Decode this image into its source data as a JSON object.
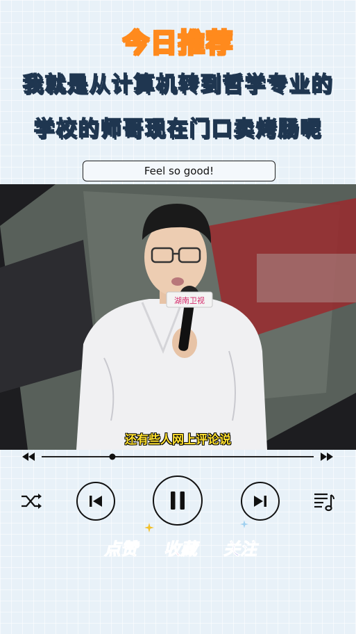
{
  "badge": {
    "label": "今日推荐"
  },
  "headline": {
    "line1": "我就是从计算机转到哲学专业的",
    "line2": "学校的师哥现在门口卖烤肠呢"
  },
  "song": {
    "title": "Feel so good!"
  },
  "video": {
    "subtitle": "还有些人网上评论说",
    "mic_label": "湖南卫视"
  },
  "player": {
    "progress": 0.26,
    "icons": {
      "rewind": "rewind-icon",
      "fast_forward": "fast-forward-icon",
      "shuffle": "shuffle-icon",
      "previous": "skip-previous-icon",
      "pause": "pause-icon",
      "next": "skip-next-icon",
      "playlist": "playlist-icon"
    }
  },
  "actions": {
    "like": "点赞",
    "favorite": "收藏",
    "follow": "关注"
  },
  "colors": {
    "background": "#e8f1f8",
    "headline_stroke": "#1f3650",
    "badge_fill": "#ffe36a",
    "badge_stroke": "#ff8a1d",
    "subtitle": "#ffe02e",
    "like": "#ffa428",
    "favorite": "#f04a8b",
    "follow": "#7d7ae8"
  }
}
